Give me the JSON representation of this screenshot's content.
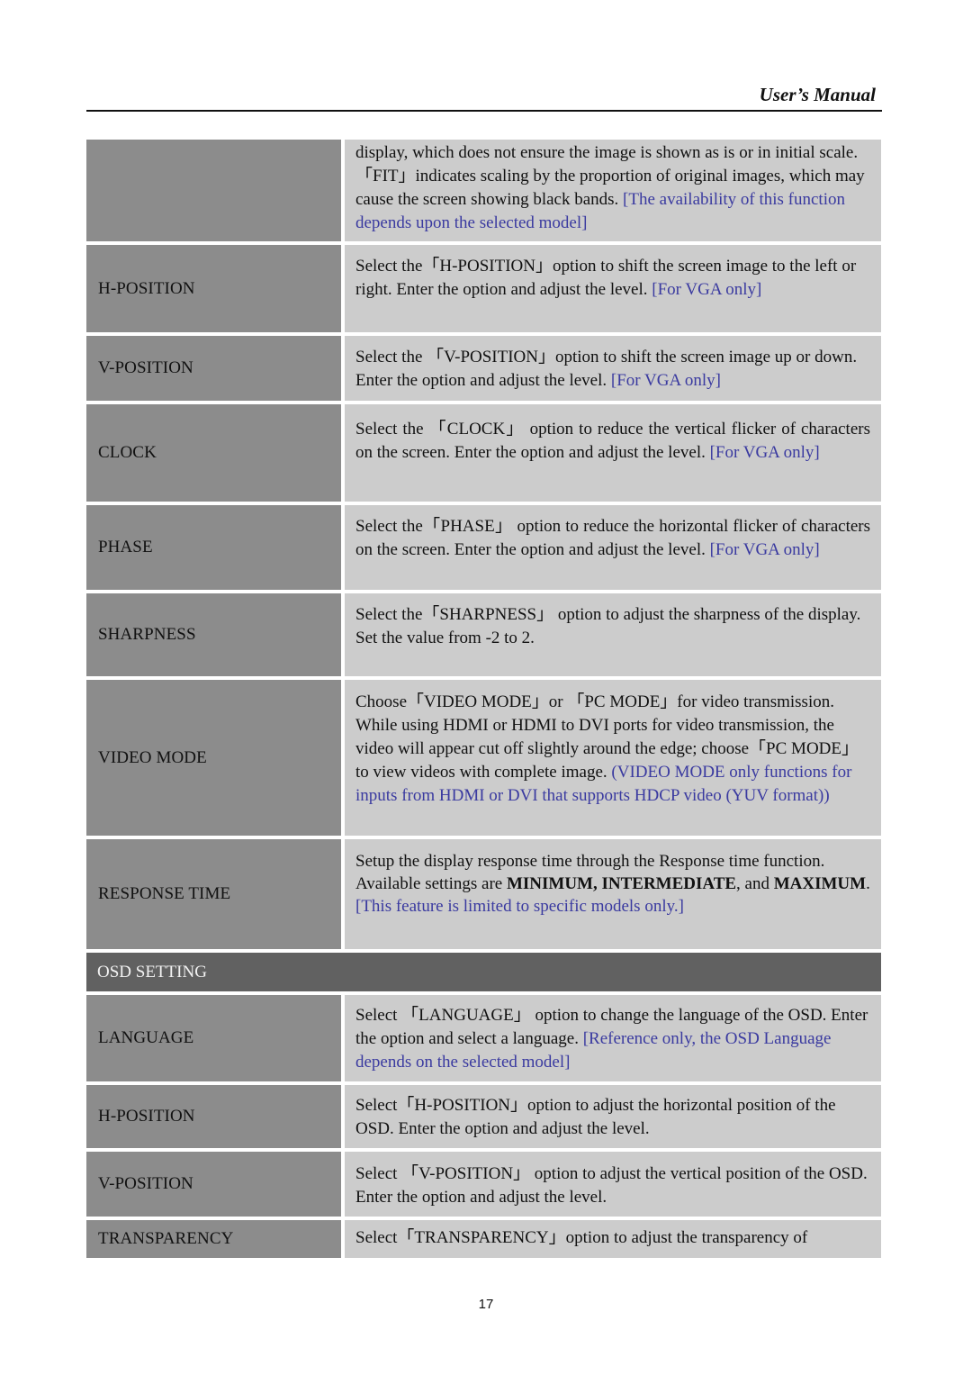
{
  "header": {
    "title": "User’s Manual"
  },
  "rows": [
    {
      "label": "",
      "text": "display, which does not ensure the image is shown as is or in initial scale.「FIT」indicates scaling by the proportion of original images, which may cause the screen showing black bands. ",
      "note": "[The availability of this function depends upon the selected model]"
    },
    {
      "label": "H-POSITION",
      "text": "Select the「H-POSITION」option to shift the screen image to the left or right. Enter the option and adjust the level. ",
      "note": "[For VGA only]"
    },
    {
      "label": "V-POSITION",
      "text": "Select the 「V-POSITION」option to shift the screen image up or down. Enter the option and adjust the level. ",
      "note": "[For VGA only]"
    },
    {
      "label": "CLOCK",
      "text": "Select the 「CLOCK」 option to reduce the vertical flicker of characters on the screen. Enter the option and adjust the level. ",
      "note": "[For VGA only]"
    },
    {
      "label": "PHASE",
      "text": "Select the「PHASE」 option to reduce the horizontal flicker of characters on the screen. Enter the option and adjust the level. ",
      "note": "[For VGA only]"
    },
    {
      "label": "SHARPNESS",
      "text": "Select the「SHARPNESS」 option to adjust the sharpness of the display. Set the value from -2 to 2.",
      "note": ""
    },
    {
      "label": "VIDEO MODE",
      "text": "Choose「VIDEO MODE」or 「PC MODE」for video transmission. While using HDMI or HDMI to DVI ports for video transmission, the video will appear cut off slightly around the edge; choose「PC MODE」to view videos with complete image. ",
      "note": "(VIDEO MODE only functions for inputs from HDMI or DVI that supports HDCP video (YUV format))"
    }
  ],
  "response_time": {
    "label": "RESPONSE TIME",
    "text_a": "Setup the display response time through the Response time function. Available settings are ",
    "bold_a": "MINIMUM,",
    "text_b": " ",
    "bold_b": "INTERMEDIATE",
    "text_c": ", and ",
    "bold_c": "MAXIMUM",
    "text_d": ". ",
    "note": "[This feature is limited to specific models only.]"
  },
  "section": {
    "title": "OSD SETTING"
  },
  "osd_rows": [
    {
      "label": "LANGUAGE",
      "text": "Select 「LANGUAGE」 option to change the language of the OSD. Enter the option and select a language. ",
      "note": "[Reference only, the OSD Language depends on the selected model]"
    },
    {
      "label": "H-POSITION",
      "text": "Select「H-POSITION」option to adjust the horizontal position of the OSD. Enter the option and adjust the level.",
      "note": ""
    },
    {
      "label": "V-POSITION",
      "text": "Select 「V-POSITION」 option to adjust the vertical position of the OSD. Enter the option and adjust the level.",
      "note": ""
    },
    {
      "label": "TRANSPARENCY",
      "text": "Select「TRANSPARENCY」option to adjust the transparency of",
      "note": ""
    }
  ],
  "footer": {
    "page_number": "17"
  }
}
